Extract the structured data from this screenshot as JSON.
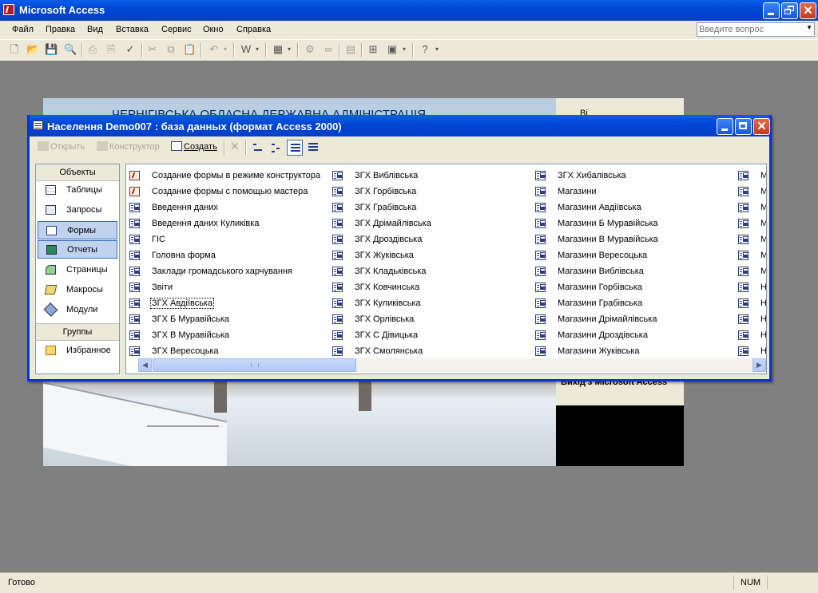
{
  "app": {
    "title": "Microsoft Access"
  },
  "menu": [
    "Файл",
    "Правка",
    "Вид",
    "Вставка",
    "Сервис",
    "Окно",
    "Справка"
  ],
  "help_box": {
    "placeholder": "Введите вопрос"
  },
  "background_form": {
    "title": "ЧЕРНІГІВСЬКА ОБЛАСНА ДЕРЖАВНА АДМІНІСТРАЦІЯ",
    "side_top": "Ві",
    "exit_label": "Вихід з Microsoft Access"
  },
  "db_window": {
    "title": "Населення Demo007 : база данных (формат Access 2000)",
    "toolbar": {
      "open": "Открыть",
      "design": "Конструктор",
      "create": "Создать"
    }
  },
  "objects_bar": {
    "objects_header": "Объекты",
    "items": [
      "Таблицы",
      "Запросы",
      "Формы",
      "Отчеты",
      "Страницы",
      "Макросы",
      "Модули"
    ],
    "groups_header": "Группы",
    "favorites": "Избранное"
  },
  "list": {
    "col1": [
      "Создание формы в режиме конструктора",
      "Создание формы с помощью мастера",
      "Введення даних",
      "Введення даних Куликівка",
      "ГІС",
      "Головна форма",
      "Заклади громадського харчування",
      "Звіти",
      "ЗГХ Авдіївська",
      "ЗГХ Б Муравійська",
      "ЗГХ В Муравійська",
      "ЗГХ Вересоцька"
    ],
    "col2": [
      "ЗГХ Виблівська",
      "ЗГХ Горбівська",
      "ЗГХ Грабівська",
      "ЗГХ Дрімайлівська",
      "ЗГХ Дроздівська",
      "ЗГХ Жуківська",
      "ЗГХ Кладьківська",
      "ЗГХ Ковчинська",
      "ЗГХ Куликівська",
      "ЗГХ Орлівська",
      "ЗГХ С Дівицька",
      "ЗГХ Смолянська"
    ],
    "col3": [
      "ЗГХ Хибалівська",
      "Магазини",
      "Магазини Авдіївська",
      "Магазини Б Муравійська",
      "Магазини В Муравійська",
      "Магазини Вересоцька",
      "Магазини Виблівська",
      "Магазини Горбівська",
      "Магазини Грабівська",
      "Магазини Дрімайлівська",
      "Магазини Дроздівська",
      "Магазини Жуківська"
    ],
    "col4": [
      "M",
      "M",
      "M",
      "M",
      "M",
      "M",
      "M",
      "H",
      "H",
      "H",
      "H",
      "H"
    ]
  },
  "statusbar": {
    "text": "Готово",
    "num": "NUM"
  }
}
